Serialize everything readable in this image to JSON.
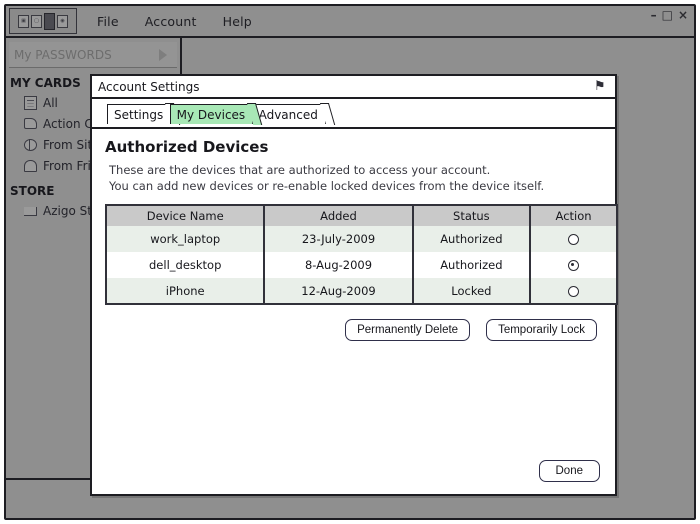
{
  "app": {
    "logo_name": "password-manager-logo",
    "menu": [
      {
        "label": "File",
        "name": "menu-file"
      },
      {
        "label": "Account",
        "name": "menu-account"
      },
      {
        "label": "Help",
        "name": "menu-help"
      }
    ],
    "window_controls": {
      "minimize": "–",
      "maximize": "□",
      "close": "×"
    }
  },
  "sidebar": {
    "passwords_header": "My PASSWORDS",
    "sections": [
      {
        "title": "MY CARDS",
        "items": [
          {
            "label": "All",
            "icon": "document-icon"
          },
          {
            "label": "Action Co",
            "icon": "hand-card-icon"
          },
          {
            "label": "From Sit",
            "icon": "globe-icon"
          },
          {
            "label": "From Fri",
            "icon": "people-icon"
          }
        ]
      },
      {
        "title": "STORE",
        "items": [
          {
            "label": "Azigo St",
            "icon": "cart-icon"
          }
        ]
      }
    ]
  },
  "dialog": {
    "title": "Account Settings",
    "pin_icon": "⚑",
    "tabs": [
      {
        "label": "Settings",
        "active": false
      },
      {
        "label": "My Devices",
        "active": true
      },
      {
        "label": "Advanced",
        "active": false
      }
    ],
    "heading": "Authorized Devices",
    "description_line1": "These are the devices that are authorized to access your account.",
    "description_line2": "You can add new devices or re-enable locked devices from the device itself.",
    "table": {
      "columns": [
        "Device Name",
        "Added",
        "Status",
        "Action"
      ],
      "rows": [
        {
          "device_name": "work_laptop",
          "added": "23-July-2009",
          "status": "Authorized",
          "selected": false
        },
        {
          "device_name": "dell_desktop",
          "added": "8-Aug-2009",
          "status": "Authorized",
          "selected": true
        },
        {
          "device_name": "iPhone",
          "added": "12-Aug-2009",
          "status": "Locked",
          "selected": false
        }
      ]
    },
    "buttons": {
      "permanently_delete": "Permanently Delete",
      "temporarily_lock": "Temporarily Lock",
      "done": "Done"
    }
  },
  "colors": {
    "window_bg": "#8f8f8f",
    "outline": "#1d1d22",
    "active_tab": "#a8e8b6",
    "table_header": "#c9c9c9",
    "row_alt": "#e9efe9",
    "button_border": "#2f2f4a"
  }
}
